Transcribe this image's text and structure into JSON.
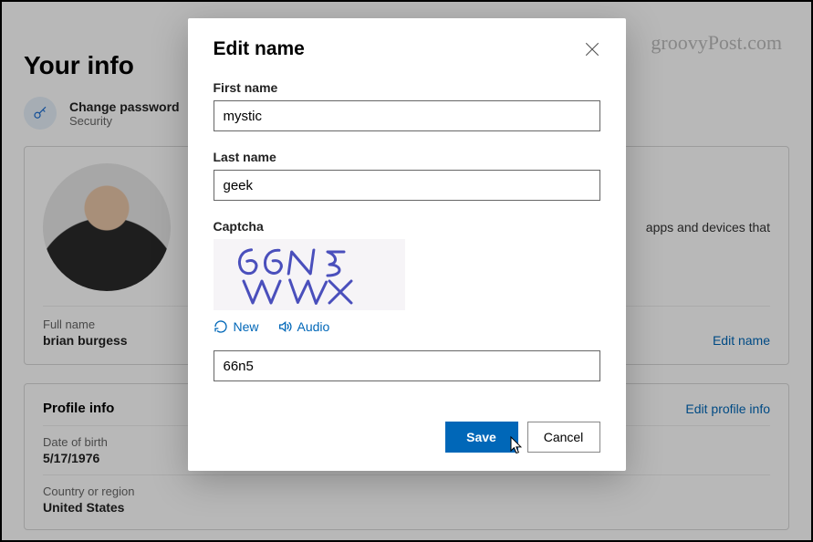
{
  "watermark": "groovyPost.com",
  "page": {
    "heading": "Your info",
    "changePassword": {
      "label": "Change password",
      "sub": "Security"
    },
    "nameCard": {
      "signInText": "apps and devices that",
      "fullNameLabel": "Full name",
      "fullNameValue": "brian burgess",
      "editLink": "Edit name"
    },
    "profileCard": {
      "title": "Profile info",
      "editLink": "Edit profile info",
      "dobLabel": "Date of birth",
      "dobValue": "5/17/1976",
      "countryLabel": "Country or region",
      "countryValue": "United States"
    }
  },
  "dialog": {
    "title": "Edit name",
    "firstNameLabel": "First name",
    "firstNameValue": "mystic",
    "lastNameLabel": "Last name",
    "lastNameValue": "geek",
    "captchaLabel": "Captcha",
    "captchaText": "66N5 WWX",
    "newLabel": "New",
    "audioLabel": "Audio",
    "captchaInputValue": "66n5",
    "saveLabel": "Save",
    "cancelLabel": "Cancel"
  }
}
